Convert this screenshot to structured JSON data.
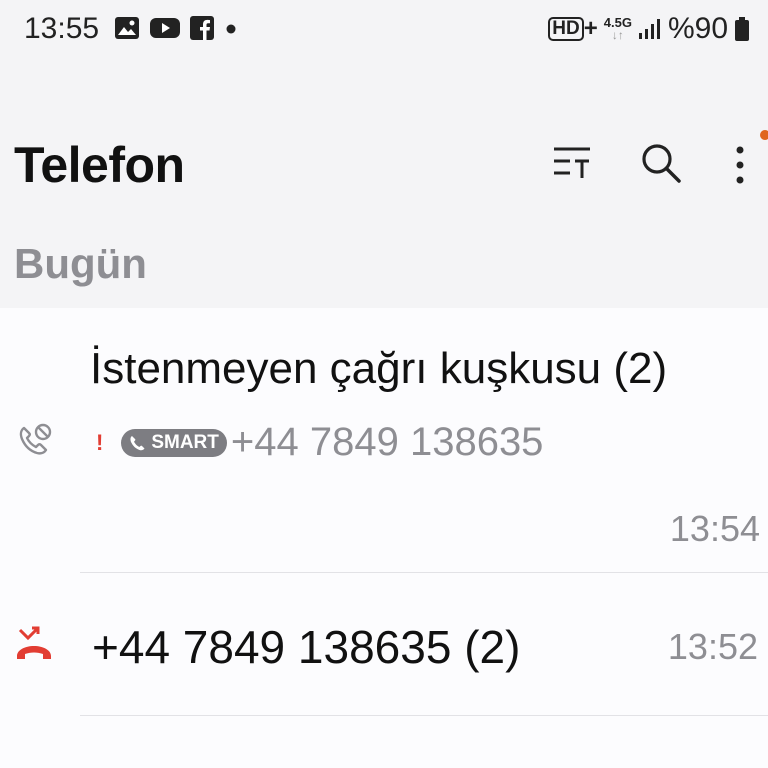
{
  "status_bar": {
    "time": "13:55",
    "battery_text": "%90",
    "hd_badge": "HD",
    "hd_plus": "+",
    "network": "4.5G",
    "left_icons": [
      "gallery-icon",
      "youtube-icon",
      "facebook-icon",
      "dot-icon"
    ],
    "right_icons": [
      "hd-voice-icon",
      "data-arrows-icon",
      "signal-icon",
      "battery-icon"
    ]
  },
  "header": {
    "title": "Telefon",
    "icons": [
      "filter-icon",
      "search-icon",
      "more-vertical-icon"
    ],
    "notification_dot_color": "#e0651e"
  },
  "sections": [
    {
      "label": "Bugün",
      "calls": [
        {
          "name": "İstenmeyen çağrı kuşkusu (2)",
          "alert_mark": "!",
          "badge": "SMART",
          "number": "+44 7849 138635",
          "time": "13:54",
          "icon": "blocked-call-icon"
        },
        {
          "name": "+44 7849 138635 (2)",
          "time": "13:52",
          "icon": "missed-call-icon",
          "icon_color": "#e23d33"
        }
      ]
    }
  ]
}
